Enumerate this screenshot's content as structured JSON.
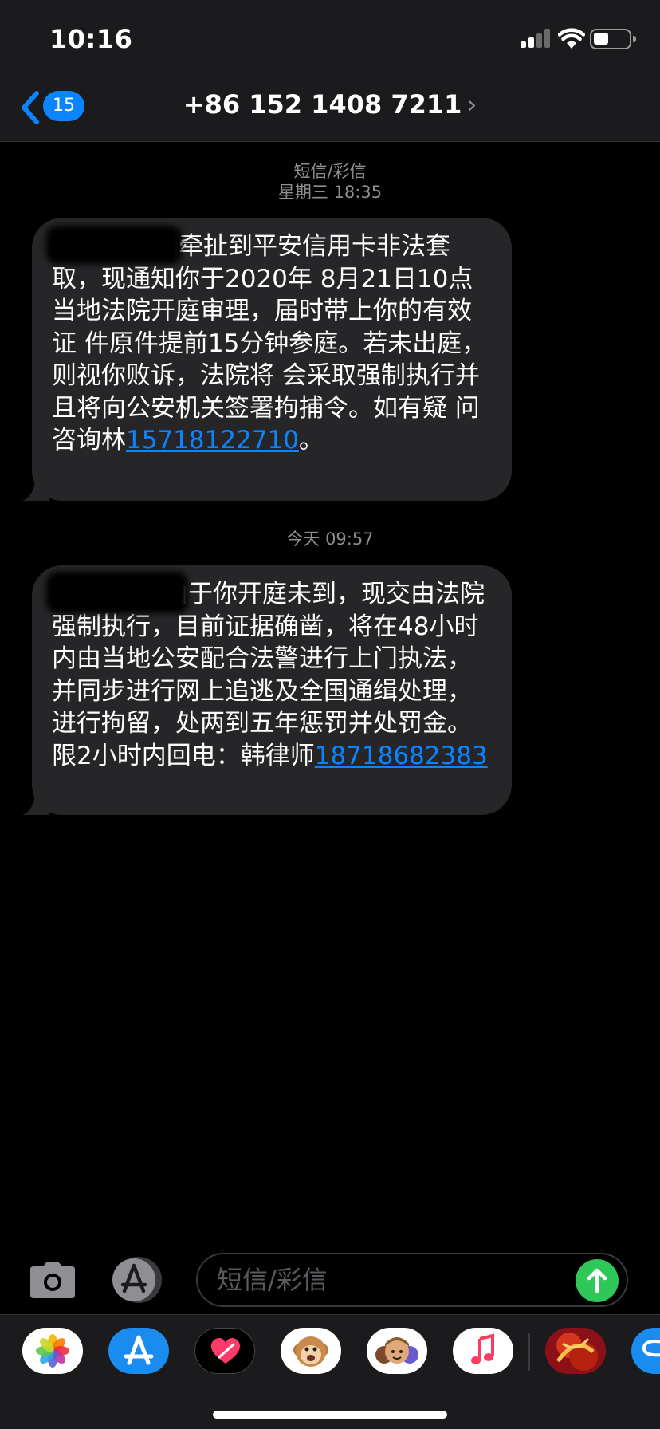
{
  "status_bar": {
    "time": "10:16"
  },
  "nav": {
    "back_count": "15",
    "contact": "+86 152 1408 7211"
  },
  "thread": {
    "meta_service": "短信/彩信",
    "meta_first_time": "星期三 18:35",
    "msg1_text": "因牵扯到平安信用卡非法套取，现通知你于2020年 8月21日10点当地法院开庭审理，届时带上你的有效证 件原件提前15分钟参庭。若未出庭，则视你败诉，法院将 会采取强制执行并且将向公安机关签署拘捕令。如有疑 问咨询林",
    "msg1_link": "15718122710",
    "msg1_end": "。",
    "meta_second_time": "今天 09:57",
    "msg2_text": "由于你开庭未到，现交由法院强制执行，目前证据确凿，将在48小时内由当地公安配合法警进行上门执法，并同步进行网上追逃及全国通缉处理，进行拘留，处两到五年惩罚并处罚金。限2小时内回电：韩律师",
    "msg2_link": "18718682383"
  },
  "composer": {
    "placeholder": "短信/彩信"
  },
  "drawer": {
    "apps": [
      "photos-icon",
      "app-store-icon",
      "digital-touch-icon",
      "animoji-icon",
      "memoji-icon",
      "music-icon",
      "game-icon",
      "partial-app-icon"
    ]
  },
  "colors": {
    "accent": "#0a84ff",
    "send": "#30c759",
    "bubble": "#262628",
    "bar": "#1b1b1d"
  }
}
